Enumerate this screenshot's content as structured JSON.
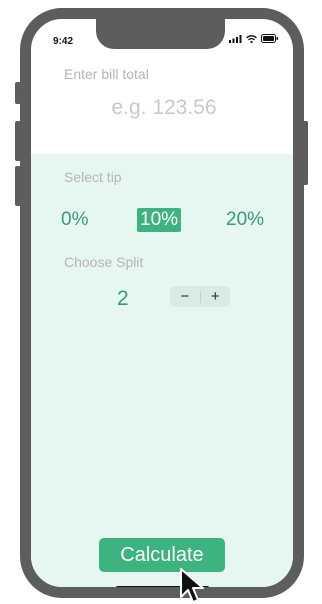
{
  "status_bar": {
    "time": "9:42",
    "icons": [
      "signal-icon",
      "wifi-icon",
      "battery-icon"
    ]
  },
  "bill": {
    "label": "Enter bill total",
    "placeholder": "e.g. 123.56"
  },
  "tip": {
    "label": "Select tip",
    "options": [
      "0%",
      "10%",
      "20%"
    ],
    "selected": "10%"
  },
  "split": {
    "label": "Choose Split",
    "value": "2",
    "decrement": "−",
    "increment": "+"
  },
  "calculate": {
    "label": "Calculate"
  },
  "colors": {
    "accent": "#3db37f",
    "panel": "#e6f7f2",
    "text_green": "#3a9a74",
    "muted": "#b5b5b5"
  }
}
